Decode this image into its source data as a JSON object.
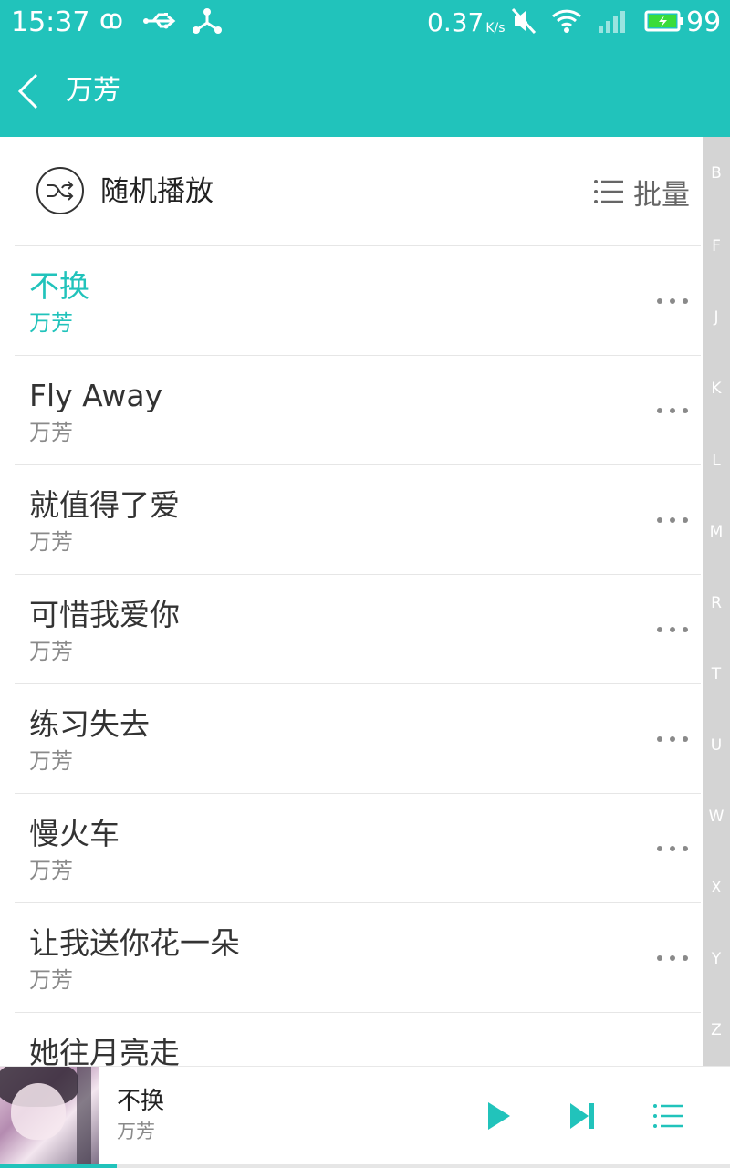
{
  "status_bar": {
    "time": "15:37",
    "net_speed": "0.37",
    "net_speed_unit": "K/s",
    "battery_percent": "99"
  },
  "app_bar": {
    "title": "万芳"
  },
  "actions": {
    "shuffle_label": "随机播放",
    "batch_label": "批量"
  },
  "songs": [
    {
      "title": "不换",
      "artist": "万芳",
      "playing": true
    },
    {
      "title": "Fly Away",
      "artist": "万芳"
    },
    {
      "title": "就值得了爱",
      "artist": "万芳"
    },
    {
      "title": "可惜我爱你",
      "artist": "万芳"
    },
    {
      "title": "练习失去",
      "artist": "万芳"
    },
    {
      "title": "慢火车",
      "artist": "万芳"
    },
    {
      "title": "让我送你花一朵",
      "artist": "万芳"
    },
    {
      "title": "她往月亮走",
      "artist": ""
    }
  ],
  "alphabet_index": [
    "B",
    "F",
    "J",
    "K",
    "L",
    "M",
    "R",
    "T",
    "U",
    "W",
    "X",
    "Y",
    "Z"
  ],
  "mini_player": {
    "title": "不换",
    "artist": "万芳",
    "progress": 0.16
  },
  "colors": {
    "accent": "#21c3bb",
    "index_bg": "#d4d4d4"
  }
}
